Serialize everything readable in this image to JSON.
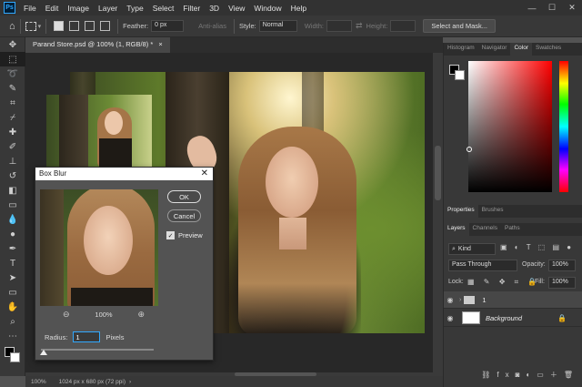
{
  "menubar": {
    "logo": "Ps",
    "items": [
      "File",
      "Edit",
      "Image",
      "Layer",
      "Type",
      "Select",
      "Filter",
      "3D",
      "View",
      "Window",
      "Help"
    ],
    "window_controls": [
      "—",
      "☐",
      "✕"
    ]
  },
  "options_bar": {
    "feather_label": "Feather:",
    "feather_value": "0 px",
    "anti_alias_label": "Anti-alias",
    "style_label": "Style:",
    "style_value": "Normal",
    "width_label": "Width:",
    "height_label": "Height:",
    "select_mask_label": "Select and Mask..."
  },
  "document_tab": {
    "title": "Parand Store.psd @ 100% (1, RGB/8) *",
    "close": "×"
  },
  "status_bar": {
    "zoom": "100%",
    "doc_size": "1024 px x 680 px (72 ppi)"
  },
  "dialog": {
    "title": "Box Blur",
    "close": "✕",
    "ok_label": "OK",
    "cancel_label": "Cancel",
    "preview_label": "Preview",
    "preview_checked": true,
    "zoom_level": "100%",
    "radius_label": "Radius:",
    "radius_value": "1",
    "radius_unit": "Pixels"
  },
  "right_panel": {
    "color_tabs": [
      "Histogram",
      "Navigator",
      "Color",
      "Swatches"
    ],
    "active_color_tab": "Color",
    "properties_tabs": [
      "Properties",
      "Brushes"
    ],
    "layers_tabs": [
      "Layers",
      "Channels",
      "Paths"
    ],
    "kind_label": "Kind",
    "blend_mode": "Pass Through",
    "opacity_label": "Opacity:",
    "opacity_value": "100%",
    "lock_label": "Lock:",
    "fill_label": "Fill:",
    "fill_value": "100%",
    "layers": [
      {
        "name": "1",
        "type": "group"
      },
      {
        "name": "Background",
        "type": "pixel",
        "locked": true
      }
    ]
  },
  "colors": {
    "accent_blue": "#31a8ff",
    "panel_bg": "#383838",
    "workspace_bg": "#282828"
  }
}
